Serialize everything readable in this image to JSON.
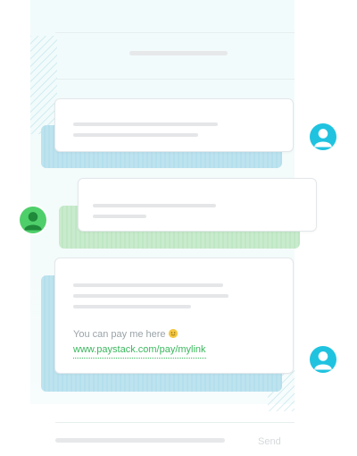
{
  "conversation": {
    "message_prefix": "You can pay me here",
    "emoji_icon": "smiley-icon",
    "payment_link": "www.paystack.com/pay/mylink"
  },
  "composer": {
    "send_label": "Send"
  },
  "colors": {
    "user_avatar": "#1fc3e0",
    "contact_avatar": "#4fcf6a",
    "link": "#3bb75e",
    "outgoing_shadow": "#bde3ef",
    "incoming_shadow": "#c9ebcd"
  }
}
